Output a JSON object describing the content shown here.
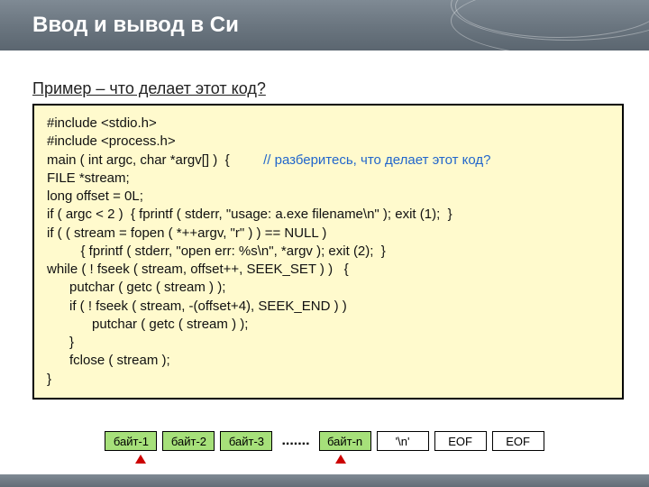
{
  "header": {
    "title": "Ввод и вывод в Си"
  },
  "subtitle": "Пример – что делает этот код?",
  "code": {
    "l1": "#include <stdio.h>",
    "l2": "#include <process.h>",
    "l3a": "main ( int argc, char *argv[] )  {         ",
    "l3b": "// разберитесь, что делает этот код?",
    "l4": "FILE *stream;",
    "l5": "long offset = 0L;",
    "l6": "if ( argc < 2 )  { fprintf ( stderr, \"usage: a.exe filename\\n\" ); exit (1);  }",
    "l7": "if ( ( stream = fopen ( *++argv, \"r\" ) ) == NULL )",
    "l8": "         { fprintf ( stderr, \"open err: %s\\n\", *argv ); exit (2);  }",
    "l9": "while ( ! fseek ( stream, offset++, SEEK_SET ) )   {",
    "l10": "      putchar ( getc ( stream ) );",
    "l11": "      if ( ! fseek ( stream, -(offset+4), SEEK_END ) )",
    "l12": "            putchar ( getc ( stream ) );",
    "l13": "      }",
    "l14": "      fclose ( stream );",
    "l15": "}"
  },
  "bytes": {
    "b1": "байт-1",
    "b2": "байт-2",
    "b3": "байт-3",
    "dots": ".......",
    "bn": "байт-n",
    "nl": "'\\n'",
    "eof1": "EOF",
    "eof2": "EOF"
  }
}
